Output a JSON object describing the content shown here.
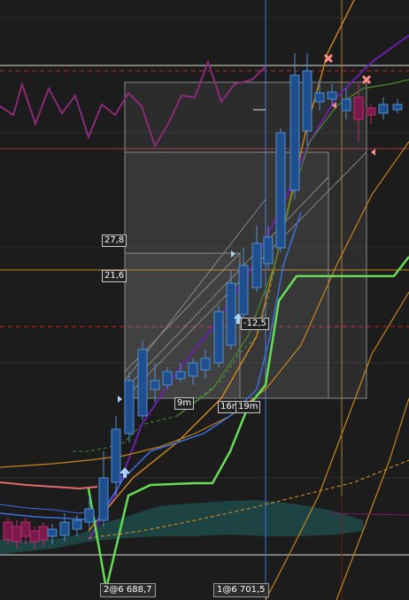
{
  "colors": {
    "background": "#1c1c1c",
    "bull_fill": "#1f4f8c",
    "bull_edge": "#4f8fd6",
    "bear_fill": "#7a1a4a",
    "bear_edge": "#c02a72",
    "cloud": "#1f4a4a",
    "green_line": "#66dd55",
    "orange_line": "#c8851e",
    "purple_line": "#6a1fa8",
    "magenta_line": "#8a2a78",
    "red_dashed": "#c0272d",
    "blue_line": "#3c6fe0"
  },
  "annotations": {
    "level_278": "27,8",
    "level_216": "21,6",
    "level_neg125": "-12,5",
    "timer_9m": "9m",
    "timer_16m": "16m",
    "timer_19m": "19m"
  },
  "bottom_tags": {
    "tag_left": "2@6 688,7",
    "tag_right": "1@6 701,5"
  },
  "markers": {
    "up_arrow_icon": "up-arrow-icon",
    "sell_x_icon": "x-marker-icon",
    "buy_triangle_icon": "right-triangle-icon"
  }
}
